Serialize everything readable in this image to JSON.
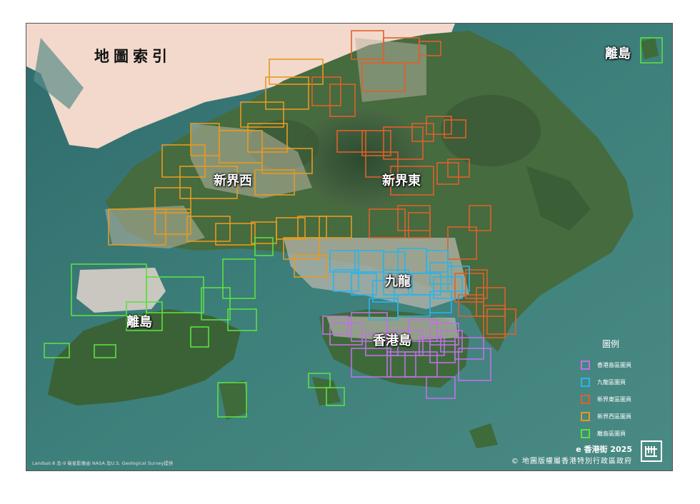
{
  "map": {
    "title": "地圖索引",
    "region_labels": {
      "nt_west": "新界西",
      "nt_east": "新界東",
      "kowloon": "九龍",
      "hk_island": "香港島",
      "islands_main": "離島",
      "islands_inset": "離島"
    },
    "legend": {
      "title": "圖例",
      "items": [
        {
          "label": "香港島區圖頁",
          "color": "#c070e8"
        },
        {
          "label": "九龍區圖頁",
          "color": "#2ab4e8"
        },
        {
          "label": "新界東區圖頁",
          "color": "#e0602a"
        },
        {
          "label": "新界西區圖頁",
          "color": "#e89a20"
        },
        {
          "label": "離島區圖頁",
          "color": "#5ce040"
        }
      ]
    },
    "footer": {
      "brand": "e 香港街  2025",
      "copyright": "© 地圖版權屬香港特別行政區政府",
      "logo_icon": "e-hkstreets-logo-icon"
    },
    "credit": "Landsat-8 及-9 衛星影像由 NASA 及U.S. Geological Survey提供"
  }
}
